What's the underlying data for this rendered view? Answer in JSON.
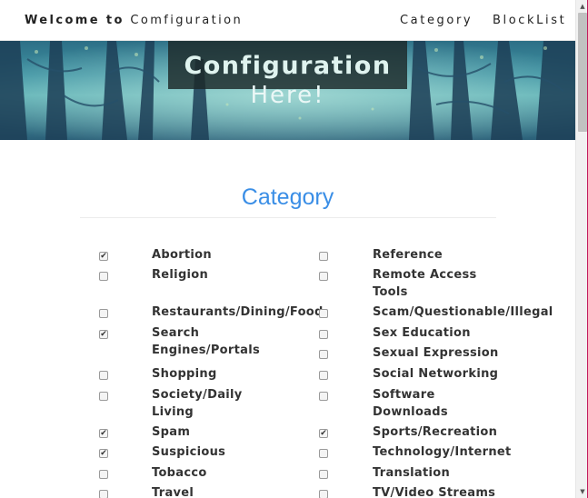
{
  "navbar": {
    "brand_bold": "Welcome to",
    "brand_rest": "Comfiguration",
    "links": [
      "Category",
      "BlockList"
    ]
  },
  "hero": {
    "title": "Configuration",
    "subtitle": "Here!"
  },
  "section": {
    "title": "Category"
  },
  "categories": {
    "left": [
      {
        "label": "Abortion",
        "checked": true
      },
      {
        "label": "Religion",
        "checked": false
      },
      {
        "label": "Restaurants/Dining/Food",
        "checked": false
      },
      {
        "label": "Search Engines/Portals",
        "checked": true
      },
      {
        "label": "Shopping",
        "checked": false
      },
      {
        "label": "Society/Daily Living",
        "checked": false
      },
      {
        "label": "Spam",
        "checked": true
      },
      {
        "label": "Suspicious",
        "checked": true
      },
      {
        "label": "Tobacco",
        "checked": false
      },
      {
        "label": "Travel",
        "checked": false
      }
    ],
    "right": [
      {
        "label": "Reference",
        "checked": false
      },
      {
        "label": "Remote Access Tools",
        "checked": false
      },
      {
        "label": "Scam/Questionable/Illegal",
        "checked": false
      },
      {
        "label": "Sex Education",
        "checked": false
      },
      {
        "label": "Sexual Expression",
        "checked": false
      },
      {
        "label": "Social Networking",
        "checked": false
      },
      {
        "label": "Software Downloads",
        "checked": false
      },
      {
        "label": "Sports/Recreation",
        "checked": true
      },
      {
        "label": "Technology/Internet",
        "checked": false
      },
      {
        "label": "Translation",
        "checked": false
      },
      {
        "label": "TV/Video Streams",
        "checked": false
      }
    ]
  },
  "colors": {
    "accent": "#3a8ee6",
    "text": "#333333",
    "hero_teal": "#3f93a3"
  }
}
